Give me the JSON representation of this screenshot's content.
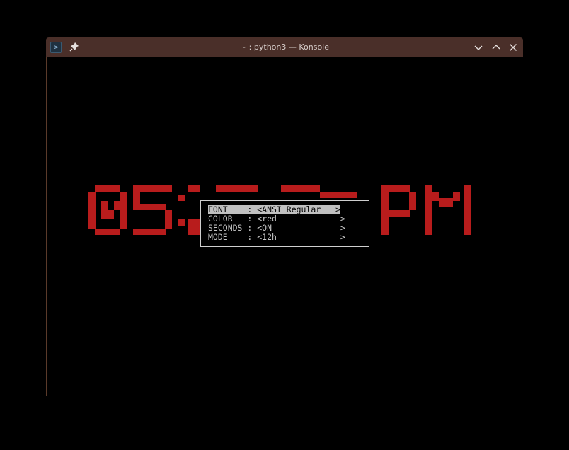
{
  "window": {
    "title": "~ : python3 — Konsole",
    "titlebar_color": "#4a2f29",
    "icons": [
      "terminal-app-icon",
      "pin-icon",
      "minimize-icon",
      "maximize-icon",
      "close-icon"
    ]
  },
  "clock": {
    "text": "05:",
    "overlapped_glyph": "7",
    "hidden_digits": "-- --",
    "meridiem": "PM",
    "color": "#b81c1c"
  },
  "menu": {
    "rows": [
      {
        "text": "FONT    : <ANSI Regular   >",
        "selected": true
      },
      {
        "text": "COLOR   : <red             >",
        "selected": false
      },
      {
        "text": "SECONDS : <ON              >",
        "selected": false
      },
      {
        "text": "MODE    : <12h             >",
        "selected": false
      }
    ],
    "selection_color": "#c0c0c0"
  }
}
